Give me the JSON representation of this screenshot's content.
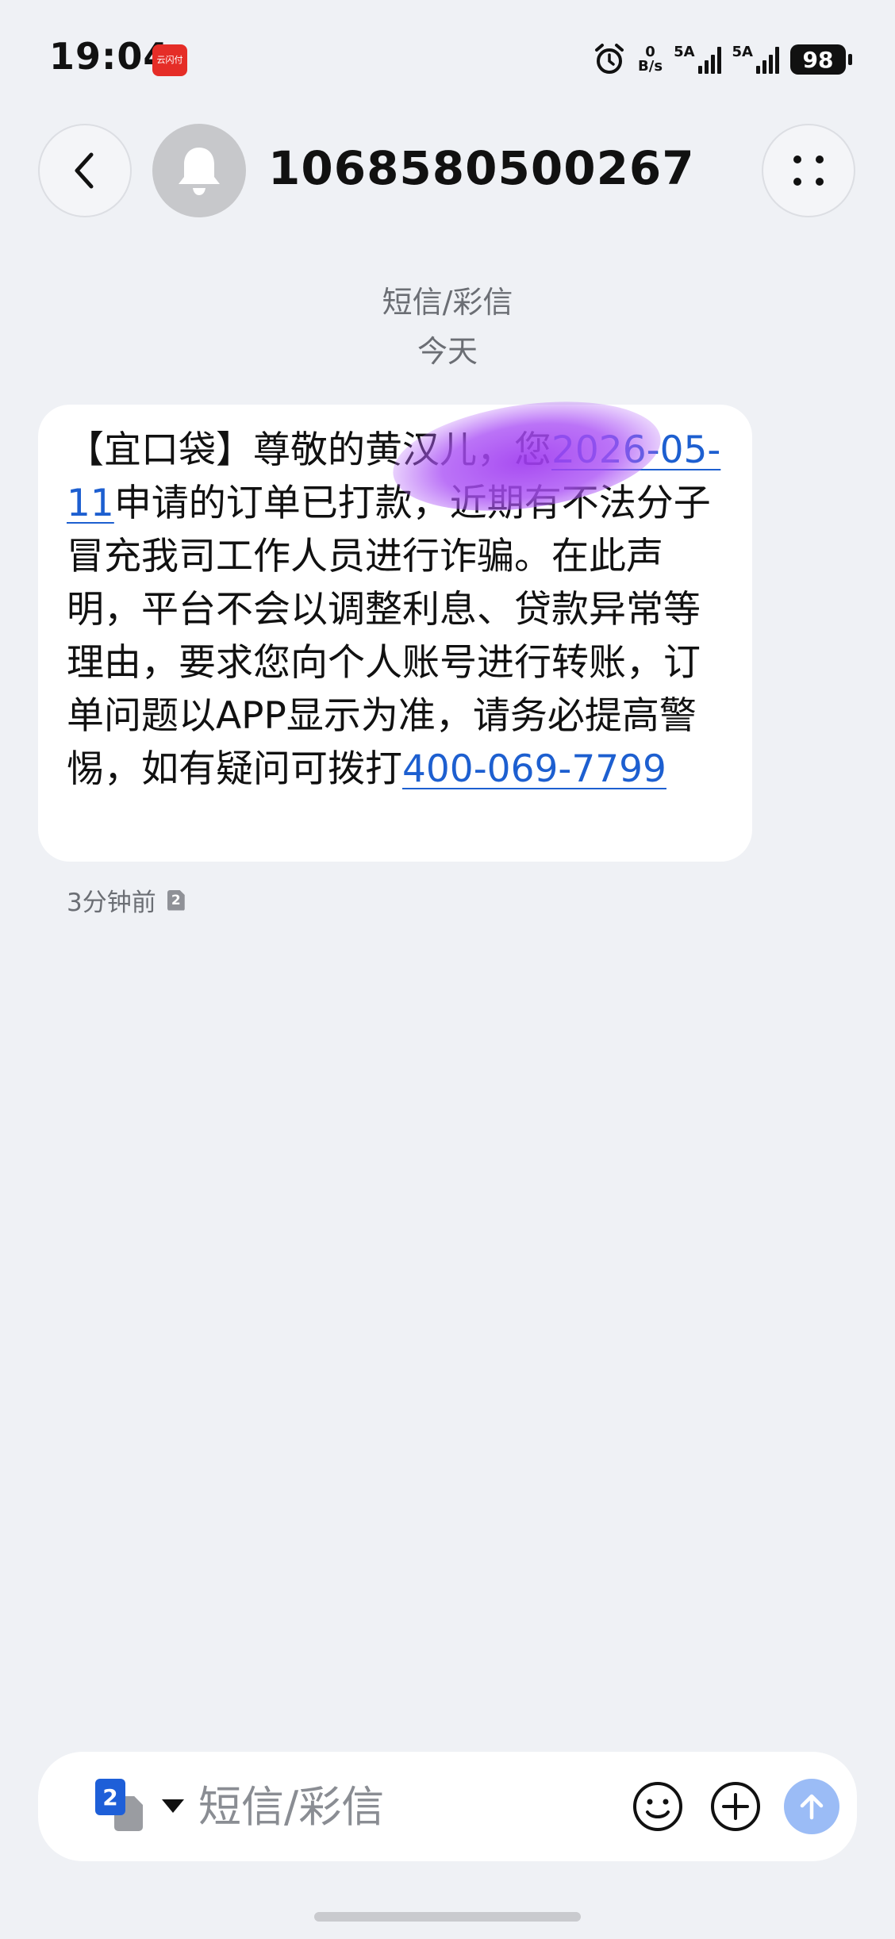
{
  "status_bar": {
    "time": "19:04",
    "app_badge_text": "云闪付",
    "net_speed_value": "0",
    "net_speed_unit": "B/s",
    "sim1_label": "5A",
    "sim2_label": "5A",
    "battery": "98"
  },
  "header": {
    "contact": "1068580500267",
    "back_icon": "chevron-left-icon",
    "avatar_icon": "bell-icon",
    "more_icon": "four-dots-icon"
  },
  "conversation": {
    "type_label": "短信/彩信",
    "date_label": "今天"
  },
  "message": {
    "part1": "【宜口袋】尊敬的黄汉儿，您",
    "date_link": "2026-05-11",
    "part2": "申请的订单已打款，近期有不法分子冒充我司工作人员进行诈骗。在此声明，平台不会以调整利息、贷款异常等理由，要求您向个人账号进行转账，订单问题以APP显示为准，请务必提高警惕，如有疑问可拨打",
    "phone_link": "400-069-7799",
    "time": "3分钟前",
    "sim_slot": "2"
  },
  "composer": {
    "sim_slot": "2",
    "placeholder": "短信/彩信",
    "emoji_icon": "smiley-icon",
    "add_icon": "plus-circle-icon",
    "send_icon": "arrow-up-icon"
  },
  "colors": {
    "background": "#eff1f5",
    "link": "#1d5fd0",
    "send_button": "#9bbcf6",
    "sim_badge": "#1e5fd8"
  }
}
